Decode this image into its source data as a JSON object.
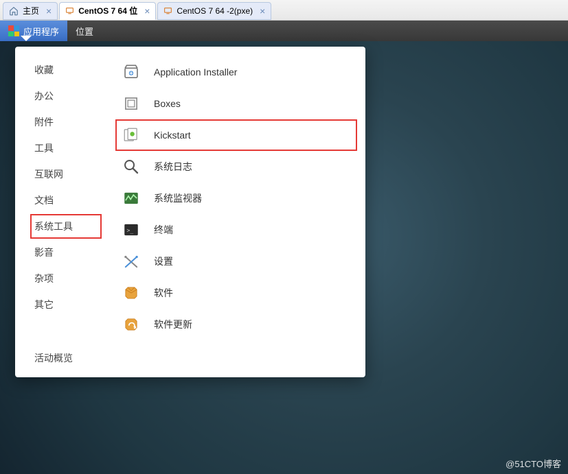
{
  "tabs": [
    {
      "label": "主页"
    },
    {
      "label": "CentOS 7 64 位"
    },
    {
      "label": "CentOS 7 64  -2(pxe)"
    }
  ],
  "menu": {
    "applications": "应用程序",
    "places": "位置"
  },
  "categories": [
    "收藏",
    "办公",
    "附件",
    "工具",
    "互联网",
    "文档",
    "系统工具",
    "影音",
    "杂项",
    "其它"
  ],
  "highlighted_category_index": 6,
  "apps": [
    {
      "label": "Application Installer",
      "icon": "installer"
    },
    {
      "label": "Boxes",
      "icon": "boxes"
    },
    {
      "label": "Kickstart",
      "icon": "kickstart"
    },
    {
      "label": "系统日志",
      "icon": "logs"
    },
    {
      "label": "系统监视器",
      "icon": "monitor"
    },
    {
      "label": "终端",
      "icon": "terminal"
    },
    {
      "label": "设置",
      "icon": "settings"
    },
    {
      "label": "软件",
      "icon": "software"
    },
    {
      "label": "软件更新",
      "icon": "updates"
    }
  ],
  "highlighted_app_index": 2,
  "activities_label": "活动概览",
  "watermark": "@51CTO博客"
}
